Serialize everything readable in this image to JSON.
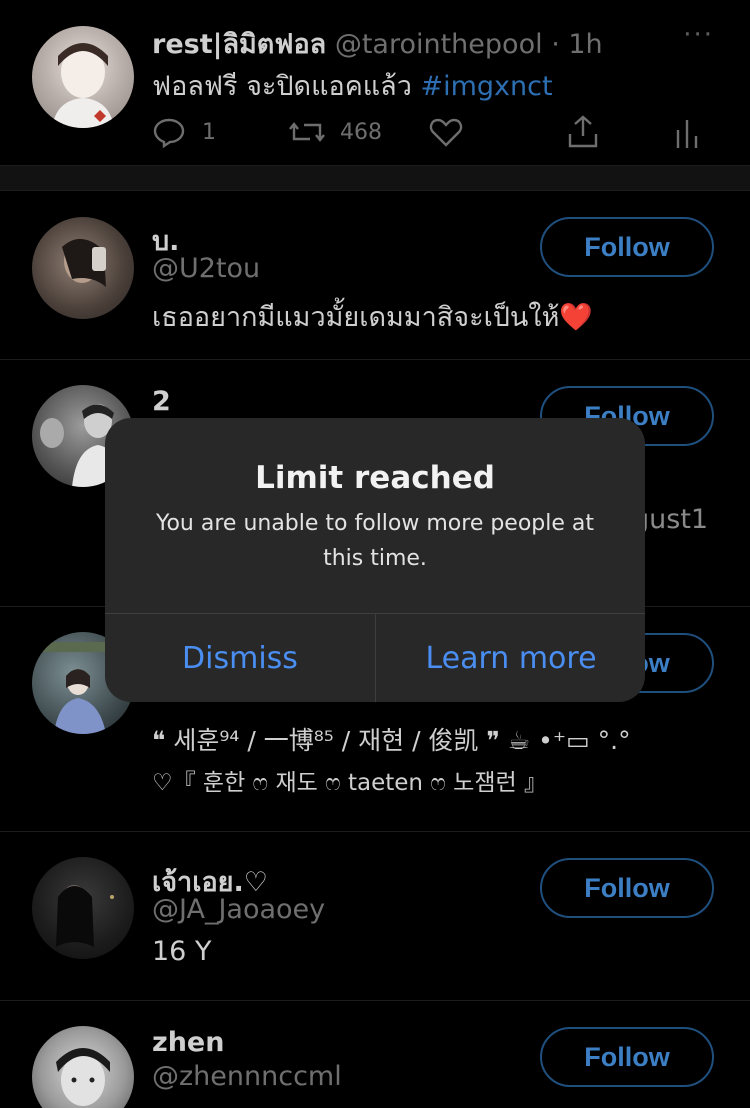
{
  "tweet": {
    "display_name": "rest|ลิมิตฟอล",
    "handle": "@tarointhepool",
    "separator": "·",
    "time": "1h",
    "more_glyph": "···",
    "text": "ฟอลฟรี จะปิดแอคแล้ว",
    "hashtag": "#imgxnct",
    "reply_count": "1",
    "retweet_count": "468"
  },
  "users": [
    {
      "name": "บ.",
      "handle": "@U2tou",
      "bio": "เธออยากมีแมวมั้ยเดมมาสิจะเป็นให้",
      "bio_emoji": "❤️",
      "follow_label": "Follow"
    },
    {
      "name": "2",
      "handle_partial": "gust1",
      "follow_label": "Follow"
    },
    {
      "bio_line1": "❝ 세훈⁹⁴ / 一博⁸⁵ / 재현 / 俊凯 ❞ ☕ •⁺▭ °.°",
      "bio_line2": "♡『 훈한 ෆ 재도 ෆ taeten ෆ 노잼런 』",
      "follow_label": "Follow"
    },
    {
      "name": "เจ้าเอย.♡",
      "handle": "@JA_Jaoaoey",
      "bio": "16 Y",
      "follow_label": "Follow"
    },
    {
      "name": "zhen",
      "handle": "@zhennnccml",
      "follow_label": "Follow"
    }
  ],
  "dialog": {
    "title": "Limit reached",
    "message": "You are unable to follow more people at this time.",
    "dismiss_label": "Dismiss",
    "learn_more_label": "Learn more"
  },
  "colors": {
    "background": "#000000",
    "accent": "#4a8ef2",
    "follow_border": "#1f4f7d",
    "dialog_bg": "#282828"
  }
}
